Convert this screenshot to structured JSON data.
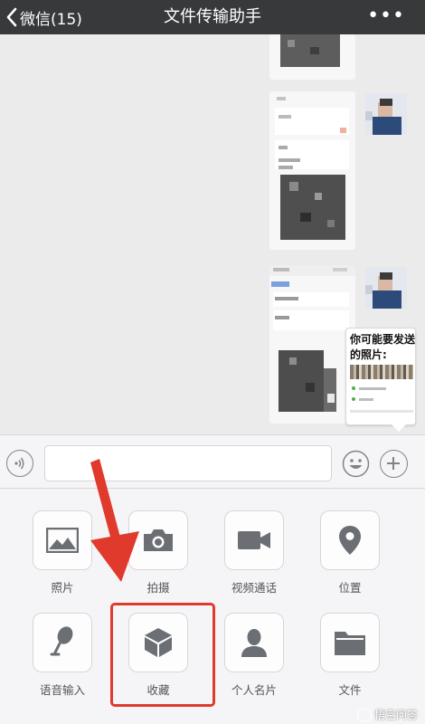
{
  "header": {
    "back_label": "微信(15)",
    "title": "文件传输助手",
    "more_label": "•••"
  },
  "popup": {
    "text": "你可能要发送的照片:"
  },
  "input": {
    "placeholder": ""
  },
  "tools": [
    {
      "label": "照片",
      "icon": "photo-icon"
    },
    {
      "label": "拍摄",
      "icon": "camera-icon"
    },
    {
      "label": "视频通话",
      "icon": "video-call-icon"
    },
    {
      "label": "位置",
      "icon": "location-icon"
    },
    {
      "label": "语音输入",
      "icon": "microphone-icon"
    },
    {
      "label": "收藏",
      "icon": "favorites-cube-icon"
    },
    {
      "label": "个人名片",
      "icon": "contact-card-icon"
    },
    {
      "label": "文件",
      "icon": "folder-icon"
    }
  ],
  "annotation": {
    "highlight_color": "#e03a2c",
    "arrow_color": "#e03a2c"
  },
  "watermark": {
    "text": "悟空问答"
  },
  "colors": {
    "header_bg": "#37393b",
    "chat_bg": "#ebebeb",
    "panel_bg": "#f5f5f7",
    "icon_gray": "#6b6f73"
  }
}
